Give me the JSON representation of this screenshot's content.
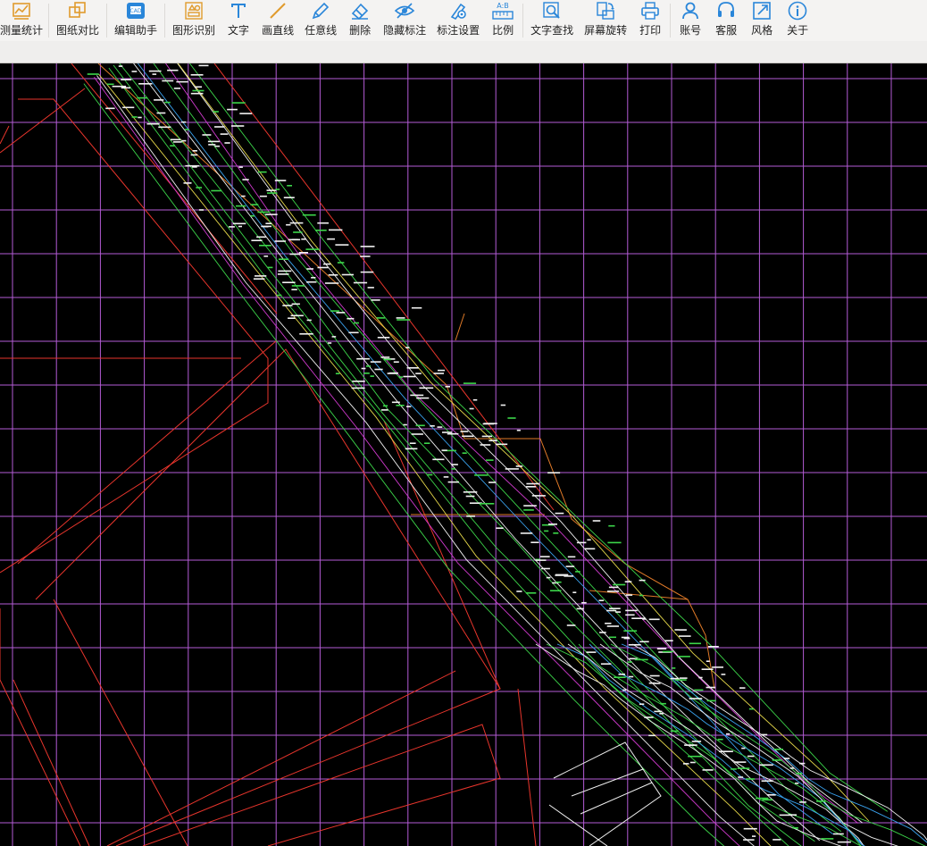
{
  "toolbar": {
    "items": [
      {
        "label": "测量统计",
        "icon": "measure-stats-icon"
      },
      {
        "label": "图纸对比",
        "icon": "compare-icon"
      },
      {
        "label": "编辑助手",
        "icon": "edit-assistant-icon"
      },
      {
        "label": "图形识别",
        "icon": "shape-recognize-icon"
      },
      {
        "label": "文字",
        "icon": "text-icon"
      },
      {
        "label": "画直线",
        "icon": "line-icon"
      },
      {
        "label": "任意线",
        "icon": "freehand-icon"
      },
      {
        "label": "删除",
        "icon": "eraser-icon"
      },
      {
        "label": "隐藏标注",
        "icon": "hide-annotation-icon"
      },
      {
        "label": "标注设置",
        "icon": "annotation-settings-icon"
      },
      {
        "label": "比例",
        "icon": "scale-icon"
      },
      {
        "label": "文字查找",
        "icon": "text-search-icon"
      },
      {
        "label": "屏幕旋转",
        "icon": "rotate-screen-icon"
      },
      {
        "label": "打印",
        "icon": "print-icon"
      },
      {
        "label": "账号",
        "icon": "account-icon"
      },
      {
        "label": "客服",
        "icon": "support-icon"
      },
      {
        "label": "风格",
        "icon": "style-icon"
      },
      {
        "label": "关于",
        "icon": "about-icon"
      }
    ]
  },
  "drawing": {
    "background": "#000000",
    "grid_color": "#b45cd6",
    "colors": {
      "boundary": "#e8352c",
      "orange": "#e07a28",
      "green": "#3cd64a",
      "white": "#f2f2f2",
      "cyan": "#3aa3f0",
      "magenta": "#d23ad0",
      "yellow": "#e6d84a"
    }
  }
}
